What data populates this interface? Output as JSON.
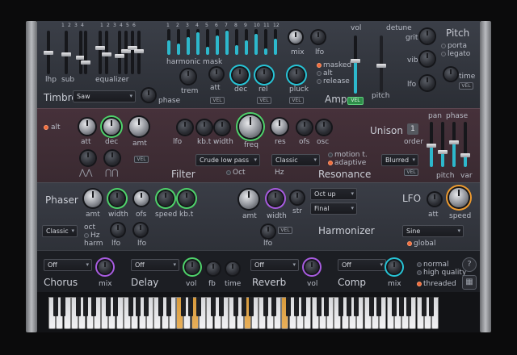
{
  "timbre": {
    "title": "Timbre",
    "wave_select": "Saw",
    "phase": "phase",
    "lhp": "lhp",
    "sub": "sub",
    "equalizer": "equalizer",
    "harmonic_mask": "harmonic mask",
    "band_numbers": [
      "1",
      "2",
      "3",
      "4",
      "1",
      "2",
      "3",
      "4",
      "5",
      "6"
    ],
    "harmonic_numbers": [
      "1",
      "2",
      "3",
      "4",
      "5",
      "6",
      "7",
      "8",
      "9",
      "10",
      "11",
      "12"
    ],
    "mix": "mix",
    "lfo": "lfo"
  },
  "amp": {
    "title": "Amp",
    "vel": "VEL",
    "trem": "trem",
    "att": "att",
    "dec": "dec",
    "rel": "rel",
    "pluck": "pluck",
    "masked": "masked",
    "alt": "alt",
    "release": "release",
    "vol": "vol",
    "pitch": "pitch",
    "env_vel": "VEL"
  },
  "pitch": {
    "title": "Pitch",
    "detune": "detune",
    "grit": "grit",
    "vib": "vib",
    "lfo": "lfo",
    "porta": "porta",
    "legato": "legato",
    "time": "time",
    "vel": "VEL"
  },
  "filter": {
    "title": "Filter",
    "alt": "alt",
    "att": "att",
    "dec": "dec",
    "amt": "amt",
    "lfo": "lfo",
    "kbt": "kb.t",
    "width": "width",
    "freq": "freq",
    "res": "res",
    "ofs": "ofs",
    "osc": "osc",
    "vel": "VEL",
    "type_select": "Crude low pass",
    "oct": "Oct",
    "hz": "Hz"
  },
  "resonance": {
    "title": "Resonance",
    "select": "Classic",
    "motion": "motion t.",
    "adaptive": "adaptive"
  },
  "unison": {
    "title": "Unison",
    "order_value": "1",
    "order": "order",
    "pan": "pan",
    "phase": "phase",
    "pitch": "pitch",
    "var": "var",
    "select": "Blurred",
    "vel": "VEL"
  },
  "phaser": {
    "title": "Phaser",
    "amt": "amt",
    "width": "width",
    "ofs": "ofs",
    "speed": "speed",
    "kbt": "kb.t",
    "select": "Classic",
    "oct": "oct",
    "hz": "Hz",
    "harm": "harm",
    "lfo": "lfo"
  },
  "harmonizer": {
    "title": "Harmonizer",
    "amt": "amt",
    "width": "width",
    "str": "str",
    "vel": "VEL",
    "interval": "Oct up",
    "mode": "Final",
    "lfo": "lfo"
  },
  "lfo": {
    "title": "LFO",
    "att": "att",
    "speed": "speed",
    "shape": "Sine",
    "global": "global"
  },
  "fx": {
    "chorus": {
      "title": "Chorus",
      "select": "Off",
      "mix": "mix"
    },
    "delay": {
      "title": "Delay",
      "select": "Off",
      "vol": "vol",
      "fb": "fb",
      "time": "time"
    },
    "reverb": {
      "title": "Reverb",
      "select": "Off",
      "vol": "vol"
    },
    "comp": {
      "title": "Comp",
      "select": "Off",
      "mix": "mix"
    },
    "normal": "normal",
    "high_quality": "high quality",
    "threaded": "threaded",
    "help": "?"
  },
  "colors": {
    "accent_cyan": "#27c4d6",
    "accent_green": "#4fd36b",
    "accent_purple": "#a85ce0",
    "accent_orange": "#ee9b2f",
    "led_on": "#f06a3a"
  }
}
